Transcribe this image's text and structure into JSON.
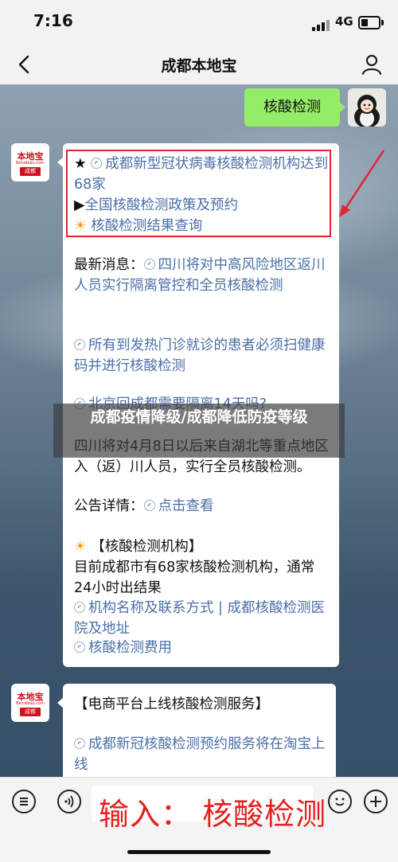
{
  "status": {
    "time": "7:16",
    "network": "4G"
  },
  "nav": {
    "title": "成都本地宝"
  },
  "logo": {
    "main": "本地宝",
    "domain": "Bendibao.com",
    "city": "成都"
  },
  "user_message": "核酸检测",
  "card1": {
    "line1_prefix": "★",
    "line1_link": "成都新型冠状病毒核酸检测机构达到68家",
    "line2_prefix": "▶",
    "line2_link": "全国核酸检测政策及预约",
    "line3_prefix": "☀",
    "line3_link": "核酸检测结果查询",
    "news_label": "最新消息：",
    "news_link": "四川将对中高风险地区返川人员实行隔离管控和全员核酸检测",
    "fever_link": "所有到发热门诊就诊的患者必须扫健康码并进行核酸检测",
    "beijing_link": "北京回成都需要隔离14天吗?",
    "policy_text": "四川将对4月8日以后来自湖北等重点地区入（返）川人员，实行全员核酸检测。",
    "notice_label": "公告详情：",
    "notice_link": "点击查看",
    "inst_prefix": "☀",
    "inst_title": "【核酸检测机构】",
    "inst_text": "目前成都市有68家核酸检测机构，通常24小时出结果",
    "inst_link1": "机构名称及联系方式 | 成都核酸检测医院及地址",
    "inst_link2": "核酸检测费用"
  },
  "card2": {
    "title": "【电商平台上线核酸检测服务】",
    "link": "成都新冠核酸检测预约服务将在淘宝上线"
  },
  "overlay_title": "成都疫情降级/成都降低防疫等级",
  "input_caption": "输入：  核酸检测",
  "colors": {
    "link": "#4a6fa8",
    "bubble": "#95ec69",
    "highlight": "#e0262c"
  }
}
